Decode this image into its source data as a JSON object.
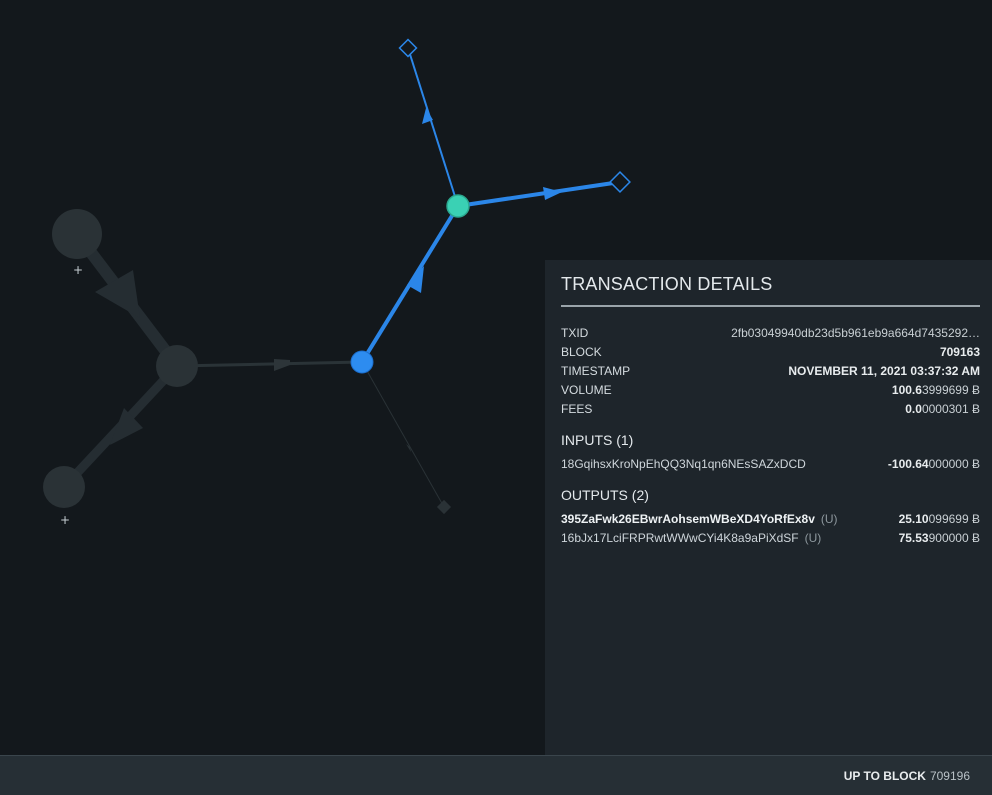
{
  "panel": {
    "title": "TRANSACTION DETAILS",
    "fields": [
      {
        "key": "TXID",
        "value": "2fb03049940db23d5b961eb9a664d7435292…"
      },
      {
        "key": "BLOCK",
        "value": "709163"
      },
      {
        "key": "TIMESTAMP",
        "value": "NOVEMBER 11, 2021 03:37:32 AM"
      },
      {
        "key": "VOLUME",
        "value_bold": "100.6",
        "value_rest": "3999699 Ƀ"
      },
      {
        "key": "FEES",
        "value_bold": "0.0",
        "value_rest": "0000301 Ƀ"
      }
    ],
    "inputs_heading": "INPUTS (1)",
    "inputs": [
      {
        "address": "18GqihsxKroNpEhQQ3Nq1qn6NEsSAZxDCD",
        "amount_bold": "-100.64",
        "amount_rest": "000000 Ƀ"
      }
    ],
    "outputs_heading": "OUTPUTS (2)",
    "outputs": [
      {
        "address": "395ZaFwk26EBwrAohsemWBeXD4YoRfEx8v",
        "tag": "(U)",
        "amount_bold": "25.10",
        "amount_rest": "099699 Ƀ"
      },
      {
        "address": "16bJx17LciFRPRwtWWwCYi4K8a9aPiXdSF",
        "tag": "(U)",
        "amount_bold": "75.53",
        "amount_rest": "900000 Ƀ"
      }
    ]
  },
  "graph": {
    "expand_glyph": "+",
    "colors": {
      "selected_edge": "#2b86e8",
      "selected_node": "#2d8cf0",
      "teal_node": "#3ad1b4",
      "inactive": "#2a3236"
    }
  },
  "footer": {
    "label": "UP TO BLOCK",
    "block": "709196"
  }
}
